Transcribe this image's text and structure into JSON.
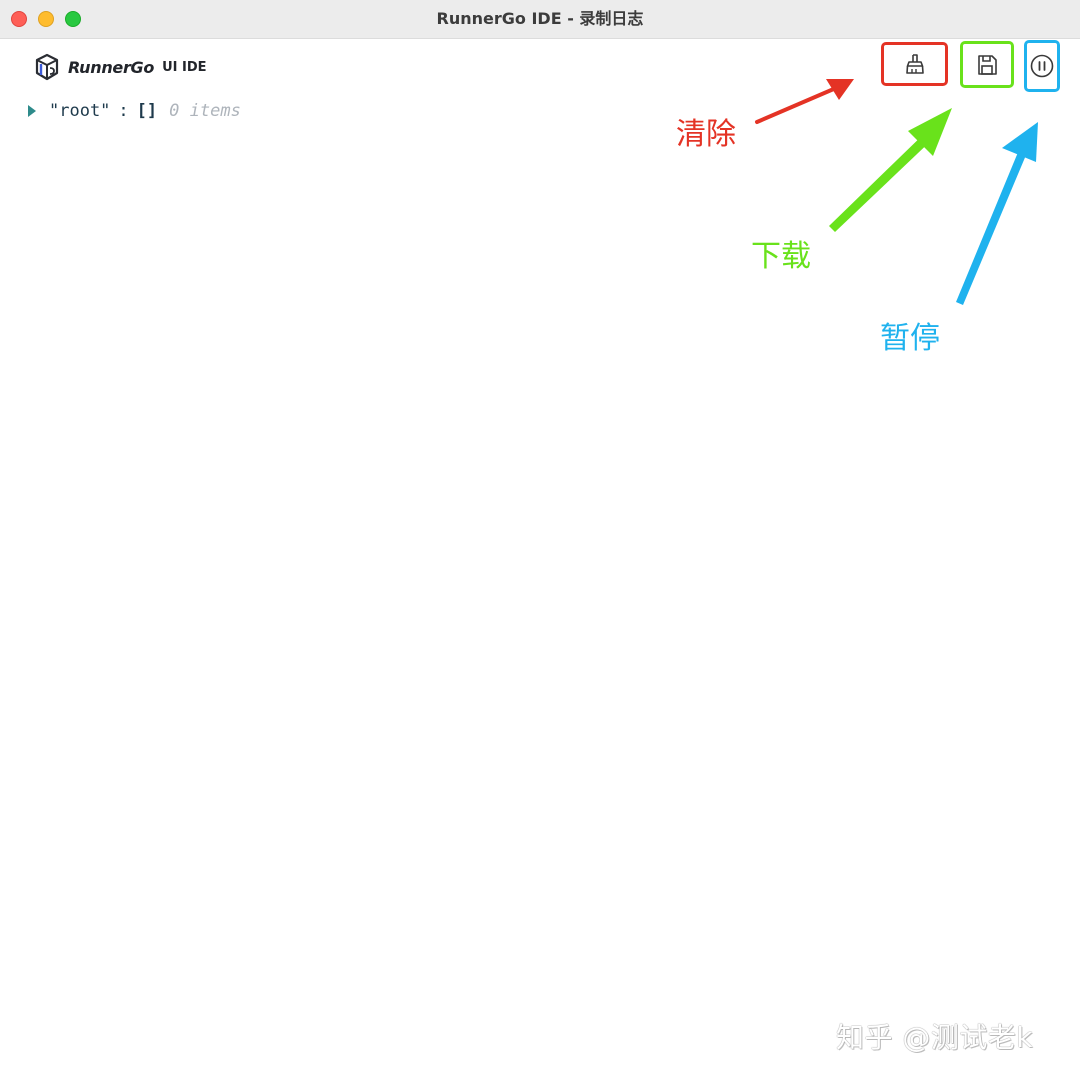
{
  "window": {
    "title": "RunnerGo IDE - 录制日志",
    "controls": [
      "close",
      "minimize",
      "zoom"
    ]
  },
  "header": {
    "logo_icon": "runnergo-cube-logo",
    "brand_name": "RunnerGo",
    "brand_suffix": "UI IDE"
  },
  "toolbar": {
    "clear": {
      "icon": "broom-icon",
      "color": "#e43325"
    },
    "download": {
      "icon": "floppy-disk-icon",
      "color": "#69e21b"
    },
    "pause": {
      "icon": "pause-circle-icon",
      "color": "#1fb2ee"
    }
  },
  "log_viewer": {
    "root": {
      "expanded": false,
      "key": "\"root\"",
      "separator": ":",
      "value": "[]",
      "count_label": "0 items"
    }
  },
  "annotations": {
    "clear_label": "清除",
    "download_label": "下载",
    "pause_label": "暂停"
  },
  "watermark": {
    "text": "知乎 @测试老k"
  },
  "colors": {
    "clear": "#e43325",
    "download": "#69e21b",
    "pause": "#1fb2ee",
    "caret": "#2e8b8b"
  }
}
